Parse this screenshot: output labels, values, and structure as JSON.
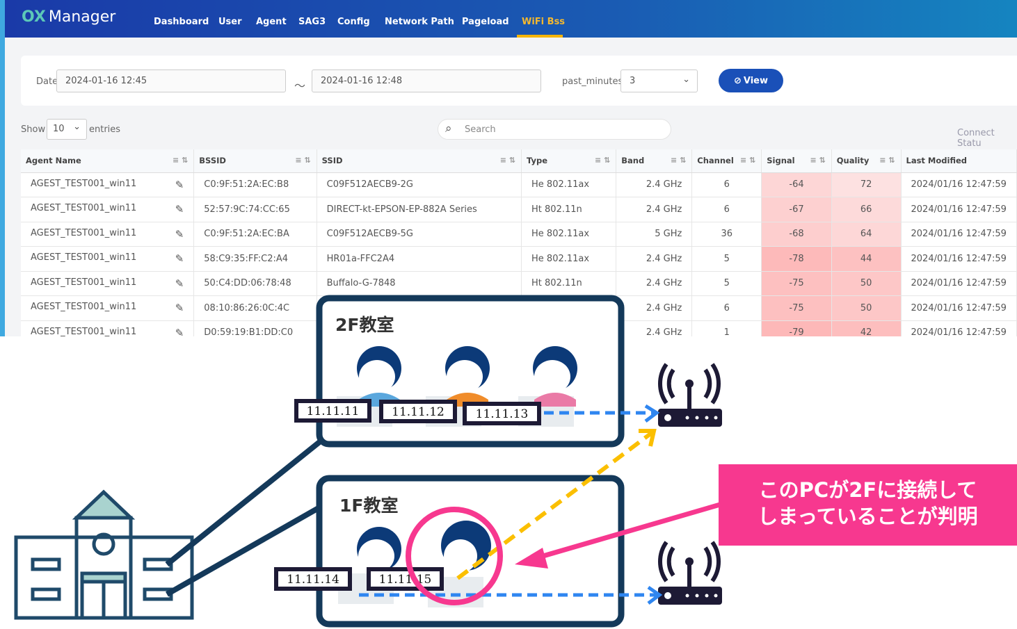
{
  "app": {
    "logo_mark": "OX",
    "logo_text": "Manager"
  },
  "nav": [
    {
      "label": "Dashboard"
    },
    {
      "label": "User"
    },
    {
      "label": "Agent"
    },
    {
      "label": "SAG3"
    },
    {
      "label": "Config"
    },
    {
      "label": "Network Path"
    },
    {
      "label": "Pageload"
    },
    {
      "label": "WiFi Bss",
      "active": true
    }
  ],
  "filter": {
    "date_label": "Date",
    "date_from": "2024-01-16 12:45",
    "separator": "～",
    "date_to": "2024-01-16 12:48",
    "past_minutes_label": "past_minutes",
    "past_minutes_value": "3",
    "view_label": "View"
  },
  "list": {
    "show_label": "Show",
    "entries_value": "10",
    "entries_label": "entries",
    "search_placeholder": "Search",
    "connect_status": "Connect Statu"
  },
  "table": {
    "columns": [
      "Agent Name",
      "BSSID",
      "SSID",
      "Type",
      "Band",
      "Channel",
      "Signal",
      "Quality",
      "Last Modified"
    ],
    "rows": [
      [
        "AGEST_TEST001_win11",
        "C0:9F:51:2A:EC:B8",
        "C09F512AECB9-2G",
        "He 802.11ax",
        "2.4 GHz",
        "6",
        "-64",
        "72",
        "2024/01/16 12:47:59"
      ],
      [
        "AGEST_TEST001_win11",
        "52:57:9C:74:CC:65",
        "DIRECT-kt-EPSON-EP-882A Series",
        "Ht 802.11n",
        "2.4 GHz",
        "6",
        "-67",
        "66",
        "2024/01/16 12:47:59"
      ],
      [
        "AGEST_TEST001_win11",
        "C0:9F:51:2A:EC:BA",
        "C09F512AECB9-5G",
        "He 802.11ax",
        "5 GHz",
        "36",
        "-68",
        "64",
        "2024/01/16 12:47:59"
      ],
      [
        "AGEST_TEST001_win11",
        "58:C9:35:FF:C2:A4",
        "HR01a-FFC2A4",
        "He 802.11ax",
        "2.4 GHz",
        "5",
        "-78",
        "44",
        "2024/01/16 12:47:59"
      ],
      [
        "AGEST_TEST001_win11",
        "50:C4:DD:06:78:48",
        "Buffalo-G-7848",
        "Ht 802.11n",
        "2.4 GHz",
        "5",
        "-75",
        "50",
        "2024/01/16 12:47:59"
      ],
      [
        "AGEST_TEST001_win11",
        "08:10:86:26:0C:4C",
        "",
        "",
        "2.4 GHz",
        "6",
        "-75",
        "50",
        "2024/01/16 12:47:59"
      ],
      [
        "AGEST_TEST001_win11",
        "D0:59:19:B1:DD:C0",
        "",
        "",
        "2.4 GHz",
        "1",
        "-79",
        "42",
        "2024/01/16 12:47:59"
      ]
    ]
  },
  "diagram": {
    "room_2f": "2F教室",
    "room_1f": "1F教室",
    "ips_2f": [
      "11.11.11",
      "11.11.12",
      "11.11.13"
    ],
    "ips_1f": [
      "11.11.14",
      "11.11.15"
    ],
    "callout_line1": "このPCが2Fに接続して",
    "callout_line2": "しまっていることが判明",
    "colors": {
      "room_border": "#14395a",
      "blue_arrow": "#2f86f0",
      "yellow_arrow": "#fbbf00",
      "pink": "#f7388f",
      "router": "#1d1a35"
    }
  }
}
